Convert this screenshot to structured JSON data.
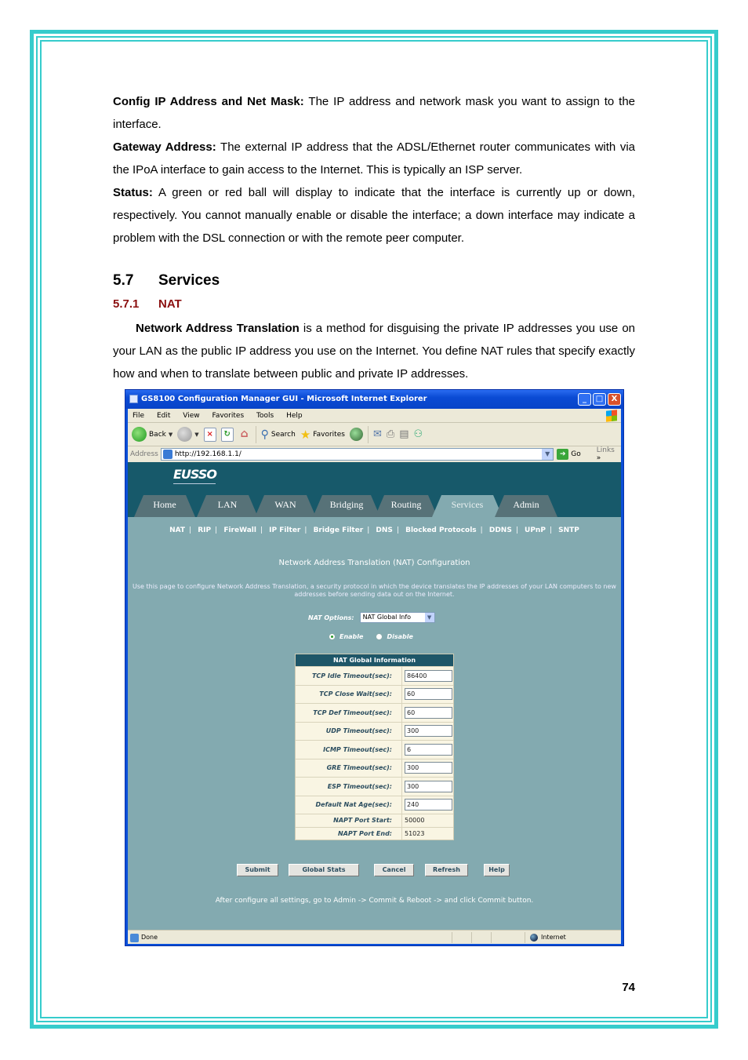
{
  "document": {
    "paragraphs": [
      {
        "term": "Config IP Address and Net Mask:",
        "text": " The IP address and network mask you want to assign to the interface."
      },
      {
        "term": "Gateway Address:",
        "text": " The external IP address that the ADSL/Ethernet router communicates with via the IPoA interface to gain access to the Internet. This is typically an ISP server."
      },
      {
        "term": "Status:",
        "text": " A green or red ball will display to indicate that the interface is currently up or down, respectively. You cannot manually enable or disable the interface; a down interface may indicate a problem with the DSL connection or with the remote peer computer."
      }
    ],
    "section": {
      "number": "5.7",
      "title": "Services"
    },
    "subsection": {
      "number": "5.7.1",
      "title": "NAT"
    },
    "nat_intro": {
      "term": "Network Address Translation",
      "text": " is a method for disguising the private IP addresses you use on your LAN as the public IP address you use on the Internet. You define NAT rules that specify exactly how and when to translate between public and private IP addresses."
    },
    "page_number": "74",
    "border_color": "#36cccc",
    "subsection_color": "#8b1010"
  },
  "browser": {
    "title": "GS8100 Configuration Manager GUI - Microsoft Internet Explorer",
    "window_buttons": [
      "_",
      "□",
      "X"
    ],
    "menu": [
      "File",
      "Edit",
      "View",
      "Favorites",
      "Tools",
      "Help"
    ],
    "toolbar": {
      "back": "Back",
      "search": "Search",
      "favorites": "Favorites"
    },
    "address_label": "Address",
    "address_value": "http://192.168.1.1/",
    "go_label": "Go",
    "links_label": "Links",
    "links_chevron": "»",
    "status_text": "Done",
    "zone_text": "Internet"
  },
  "webpage": {
    "logo": "EUSSO",
    "tabs": [
      {
        "label": "Home",
        "active": false
      },
      {
        "label": "LAN",
        "active": false
      },
      {
        "label": "WAN",
        "active": false
      },
      {
        "label": "Bridging",
        "active": false
      },
      {
        "label": "Routing",
        "active": false
      },
      {
        "label": "Services",
        "active": true
      },
      {
        "label": "Admin",
        "active": false
      }
    ],
    "subnav": [
      "NAT",
      "RIP",
      "FireWall",
      "IP Filter",
      "Bridge Filter",
      "DNS",
      "Blocked Protocols",
      "DDNS",
      "UPnP",
      "SNTP"
    ],
    "title": "Network Address Translation (NAT) Configuration",
    "description": "Use this page to configure Network Address Translation, a security protocol in which the device translates the IP addresses of your LAN computers to new addresses before sending data out on the Internet.",
    "nat_options_label": "NAT Options:",
    "nat_options_value": "NAT Global Info",
    "radio_enable": "Enable",
    "radio_disable": "Disable",
    "radio_selected": "Enable",
    "table_title": "NAT Global Information",
    "table_rows": [
      {
        "label": "TCP Idle Timeout(sec):",
        "value": "86400",
        "editable": true
      },
      {
        "label": "TCP Close Wait(sec):",
        "value": "60",
        "editable": true
      },
      {
        "label": "TCP Def Timeout(sec):",
        "value": "60",
        "editable": true
      },
      {
        "label": "UDP Timeout(sec):",
        "value": "300",
        "editable": true
      },
      {
        "label": "ICMP Timeout(sec):",
        "value": "6",
        "editable": true
      },
      {
        "label": "GRE Timeout(sec):",
        "value": "300",
        "editable": true
      },
      {
        "label": "ESP Timeout(sec):",
        "value": "300",
        "editable": true
      },
      {
        "label": "Default Nat Age(sec):",
        "value": "240",
        "editable": true
      },
      {
        "label": "NAPT Port Start:",
        "value": "50000",
        "editable": false
      },
      {
        "label": "NAPT Port End:",
        "value": "51023",
        "editable": false
      }
    ],
    "buttons": [
      "Submit",
      "Global Stats",
      "Cancel",
      "Refresh",
      "Help"
    ],
    "footer_note": "After configure all settings, go to Admin -> Commit & Reboot -> and click Commit button.",
    "colors": {
      "header": "#17596a",
      "body": "#83aab0",
      "tab": "#577278",
      "table_head": "#1e5668"
    }
  }
}
